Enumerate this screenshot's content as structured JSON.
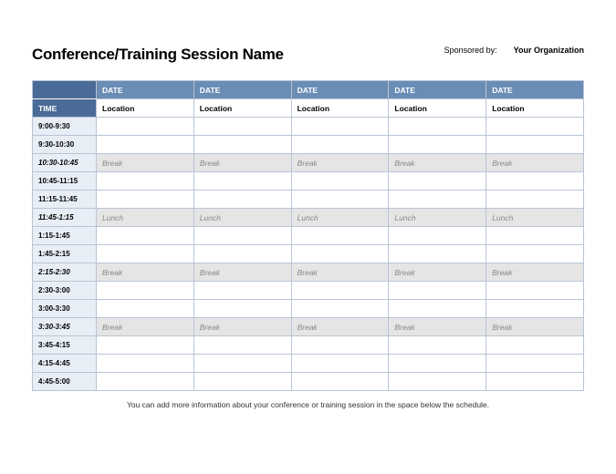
{
  "title": "Conference/Training Session Name",
  "sponsor_label": "Sponsored by:",
  "sponsor_org": "Your Organization",
  "time_header": "TIME",
  "date_headers": [
    "DATE",
    "DATE",
    "DATE",
    "DATE",
    "DATE"
  ],
  "location_labels": [
    "Location",
    "Location",
    "Location",
    "Location",
    "Location"
  ],
  "rows": [
    {
      "time": "9:00-9:30",
      "type": "session",
      "cells": [
        "",
        "",
        "",
        "",
        ""
      ]
    },
    {
      "time": "9:30-10:30",
      "type": "session",
      "cells": [
        "",
        "",
        "",
        "",
        ""
      ]
    },
    {
      "time": "10:30-10:45",
      "type": "break",
      "cells": [
        "Break",
        "Break",
        "Break",
        "Break",
        "Break"
      ]
    },
    {
      "time": "10:45-11:15",
      "type": "session",
      "cells": [
        "",
        "",
        "",
        "",
        ""
      ]
    },
    {
      "time": "11:15-11:45",
      "type": "session",
      "cells": [
        "",
        "",
        "",
        "",
        ""
      ]
    },
    {
      "time": "11:45-1:15",
      "type": "break",
      "cells": [
        "Lunch",
        "Lunch",
        "Lunch",
        "Lunch",
        "Lunch"
      ]
    },
    {
      "time": "1:15-1:45",
      "type": "session",
      "cells": [
        "",
        "",
        "",
        "",
        ""
      ]
    },
    {
      "time": "1:45-2:15",
      "type": "session",
      "cells": [
        "",
        "",
        "",
        "",
        ""
      ]
    },
    {
      "time": "2:15-2:30",
      "type": "break",
      "cells": [
        "Break",
        "Break",
        "Break",
        "Break",
        "Break"
      ]
    },
    {
      "time": "2:30-3:00",
      "type": "session",
      "cells": [
        "",
        "",
        "",
        "",
        ""
      ]
    },
    {
      "time": "3:00-3:30",
      "type": "session",
      "cells": [
        "",
        "",
        "",
        "",
        ""
      ]
    },
    {
      "time": "3:30-3:45",
      "type": "break",
      "cells": [
        "Break",
        "Break",
        "Break",
        "Break",
        "Break"
      ]
    },
    {
      "time": "3:45-4:15",
      "type": "session",
      "cells": [
        "",
        "",
        "",
        "",
        ""
      ]
    },
    {
      "time": "4:15-4:45",
      "type": "session",
      "cells": [
        "",
        "",
        "",
        "",
        ""
      ]
    },
    {
      "time": "4:45-5:00",
      "type": "session",
      "cells": [
        "",
        "",
        "",
        "",
        ""
      ]
    }
  ],
  "footer_note": "You can add more information about your conference or training session in the space below the schedule."
}
